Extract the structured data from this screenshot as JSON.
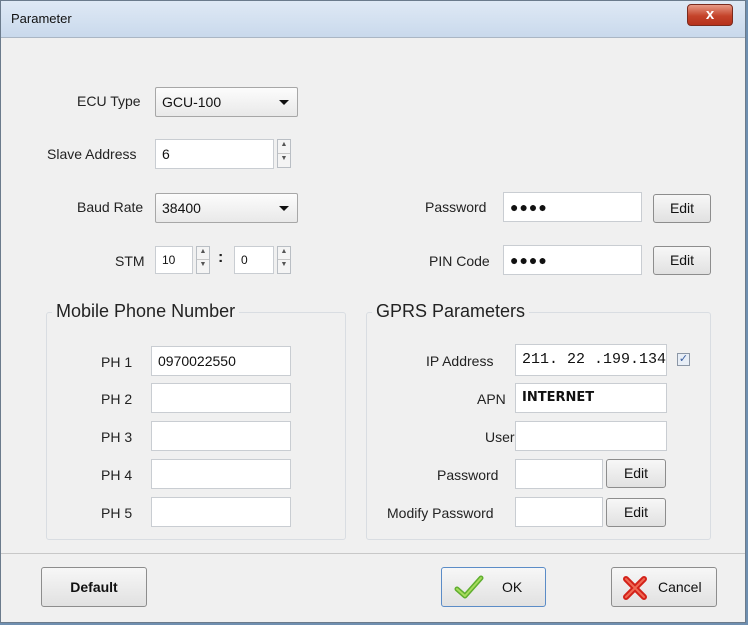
{
  "window": {
    "title": "Parameter",
    "close_glyph": "x"
  },
  "ecu": {
    "label": "ECU Type",
    "value": "GCU-100"
  },
  "slave": {
    "label": "Slave Address",
    "value": "6"
  },
  "baud": {
    "label": "Baud Rate",
    "value": "38400"
  },
  "stm": {
    "label": "STM",
    "value1": "10",
    "separator": ":",
    "value2": "0"
  },
  "password": {
    "label": "Password",
    "value": "●●●●",
    "edit_label": "Edit"
  },
  "pin": {
    "label": "PIN Code",
    "value": "●●●●",
    "edit_label": "Edit"
  },
  "mobile": {
    "title": "Mobile Phone Number",
    "phones": [
      {
        "label": "PH 1",
        "value": "0970022550"
      },
      {
        "label": "PH 2",
        "value": ""
      },
      {
        "label": "PH 3",
        "value": ""
      },
      {
        "label": "PH 4",
        "value": ""
      },
      {
        "label": "PH 5",
        "value": ""
      }
    ]
  },
  "gprs": {
    "title": "GPRS Parameters",
    "ip": {
      "label": "IP Address",
      "value": "211. 22 .199.134",
      "checked": true,
      "check_glyph": "✓"
    },
    "apn": {
      "label": "APN",
      "value": "INTERNET"
    },
    "user": {
      "label": "User",
      "value": ""
    },
    "password": {
      "label": "Password",
      "value": "",
      "edit_label": "Edit"
    },
    "modify_password": {
      "label": "Modify Password",
      "value": "",
      "edit_label": "Edit"
    }
  },
  "footer": {
    "default_label": "Default",
    "ok_label": "OK",
    "cancel_label": "Cancel",
    "ok_icon": "checkmark-icon",
    "cancel_icon": "red-x-icon"
  }
}
